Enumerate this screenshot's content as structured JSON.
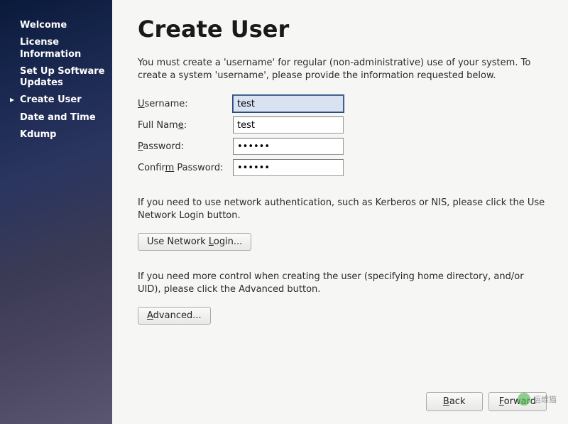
{
  "sidebar": {
    "items": [
      {
        "label": "Welcome"
      },
      {
        "label": "License Information"
      },
      {
        "label": "Set Up Software Updates"
      },
      {
        "label": "Create User"
      },
      {
        "label": "Date and Time"
      },
      {
        "label": "Kdump"
      }
    ],
    "active_index": 3
  },
  "page": {
    "title": "Create User",
    "intro": "You must create a 'username' for regular (non-administrative) use of your system.  To create a system 'username', please provide the information requested below.",
    "network_info": "If you need to use network authentication, such as Kerberos or NIS, please click the Use Network Login button.",
    "advanced_info": "If you need more control when creating the user (specifying home directory, and/or UID), please click the Advanced button."
  },
  "form": {
    "username": {
      "label_pre": "U",
      "label_rest": "sername:",
      "value": "test"
    },
    "fullname": {
      "label_pre": "Full Nam",
      "label_u": "e",
      "label_rest": ":",
      "value": "test"
    },
    "password": {
      "label_u": "P",
      "label_rest": "assword:",
      "value": "••••••"
    },
    "confirm": {
      "label_pre": "Confir",
      "label_u": "m",
      "label_rest": " Password:",
      "value": "••••••"
    }
  },
  "buttons": {
    "network_login_pre": "Use Network ",
    "network_login_u": "L",
    "network_login_rest": "ogin...",
    "advanced_u": "A",
    "advanced_rest": "dvanced...",
    "back_u": "B",
    "back_rest": "ack",
    "forward_u": "F",
    "forward_rest": "orward"
  },
  "watermark": {
    "text": "运维猫"
  }
}
